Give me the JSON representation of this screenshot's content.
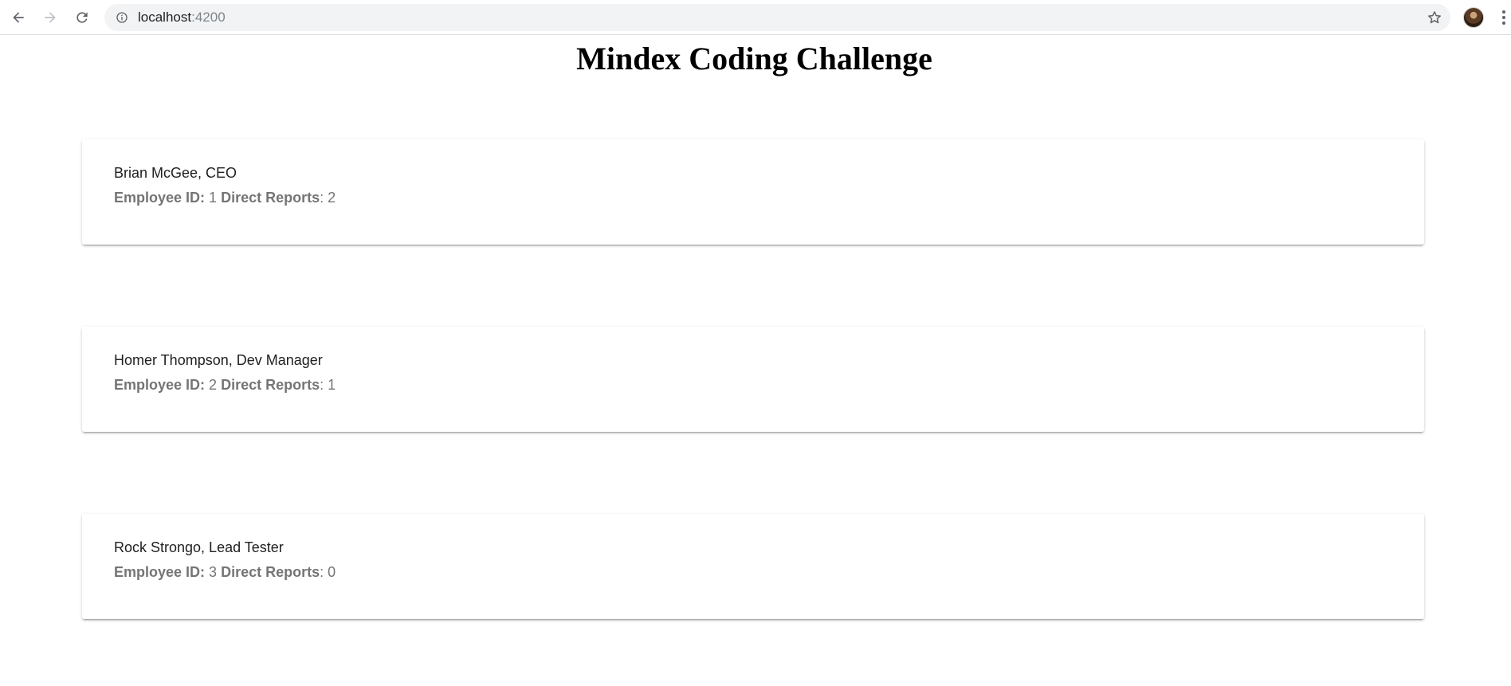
{
  "browser": {
    "url_host": "localhost",
    "url_port": ":4200"
  },
  "page": {
    "title": "Mindex Coding Challenge"
  },
  "labels": {
    "employee_id": "Employee ID:",
    "direct_reports": "Direct Reports"
  },
  "employees": [
    {
      "name": "Brian McGee, CEO",
      "id": "1",
      "direct_reports": "2"
    },
    {
      "name": "Homer Thompson, Dev Manager",
      "id": "2",
      "direct_reports": "1"
    },
    {
      "name": "Rock Strongo, Lead Tester",
      "id": "3",
      "direct_reports": "0"
    }
  ],
  "colors": {
    "text_primary": "#212121",
    "text_secondary": "#757575",
    "omnibox_bg": "#f1f3f4"
  }
}
